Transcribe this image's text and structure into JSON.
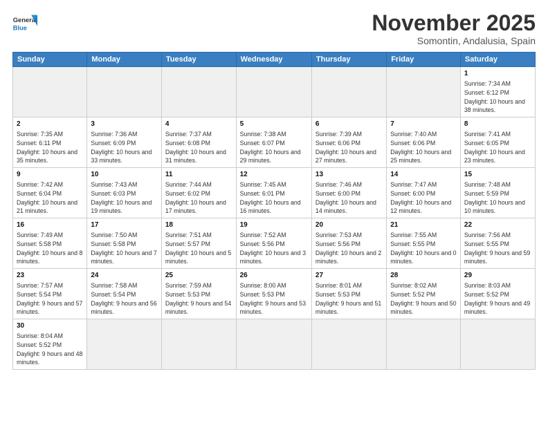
{
  "logo": {
    "line1": "General",
    "line2": "Blue"
  },
  "title": "November 2025",
  "subtitle": "Somontin, Andalusia, Spain",
  "weekdays": [
    "Sunday",
    "Monday",
    "Tuesday",
    "Wednesday",
    "Thursday",
    "Friday",
    "Saturday"
  ],
  "weeks": [
    [
      {
        "day": "",
        "info": ""
      },
      {
        "day": "",
        "info": ""
      },
      {
        "day": "",
        "info": ""
      },
      {
        "day": "",
        "info": ""
      },
      {
        "day": "",
        "info": ""
      },
      {
        "day": "",
        "info": ""
      },
      {
        "day": "1",
        "info": "Sunrise: 7:34 AM\nSunset: 6:12 PM\nDaylight: 10 hours and 38 minutes."
      }
    ],
    [
      {
        "day": "2",
        "info": "Sunrise: 7:35 AM\nSunset: 6:11 PM\nDaylight: 10 hours and 35 minutes."
      },
      {
        "day": "3",
        "info": "Sunrise: 7:36 AM\nSunset: 6:09 PM\nDaylight: 10 hours and 33 minutes."
      },
      {
        "day": "4",
        "info": "Sunrise: 7:37 AM\nSunset: 6:08 PM\nDaylight: 10 hours and 31 minutes."
      },
      {
        "day": "5",
        "info": "Sunrise: 7:38 AM\nSunset: 6:07 PM\nDaylight: 10 hours and 29 minutes."
      },
      {
        "day": "6",
        "info": "Sunrise: 7:39 AM\nSunset: 6:06 PM\nDaylight: 10 hours and 27 minutes."
      },
      {
        "day": "7",
        "info": "Sunrise: 7:40 AM\nSunset: 6:06 PM\nDaylight: 10 hours and 25 minutes."
      },
      {
        "day": "8",
        "info": "Sunrise: 7:41 AM\nSunset: 6:05 PM\nDaylight: 10 hours and 23 minutes."
      }
    ],
    [
      {
        "day": "9",
        "info": "Sunrise: 7:42 AM\nSunset: 6:04 PM\nDaylight: 10 hours and 21 minutes."
      },
      {
        "day": "10",
        "info": "Sunrise: 7:43 AM\nSunset: 6:03 PM\nDaylight: 10 hours and 19 minutes."
      },
      {
        "day": "11",
        "info": "Sunrise: 7:44 AM\nSunset: 6:02 PM\nDaylight: 10 hours and 17 minutes."
      },
      {
        "day": "12",
        "info": "Sunrise: 7:45 AM\nSunset: 6:01 PM\nDaylight: 10 hours and 16 minutes."
      },
      {
        "day": "13",
        "info": "Sunrise: 7:46 AM\nSunset: 6:00 PM\nDaylight: 10 hours and 14 minutes."
      },
      {
        "day": "14",
        "info": "Sunrise: 7:47 AM\nSunset: 6:00 PM\nDaylight: 10 hours and 12 minutes."
      },
      {
        "day": "15",
        "info": "Sunrise: 7:48 AM\nSunset: 5:59 PM\nDaylight: 10 hours and 10 minutes."
      }
    ],
    [
      {
        "day": "16",
        "info": "Sunrise: 7:49 AM\nSunset: 5:58 PM\nDaylight: 10 hours and 8 minutes."
      },
      {
        "day": "17",
        "info": "Sunrise: 7:50 AM\nSunset: 5:58 PM\nDaylight: 10 hours and 7 minutes."
      },
      {
        "day": "18",
        "info": "Sunrise: 7:51 AM\nSunset: 5:57 PM\nDaylight: 10 hours and 5 minutes."
      },
      {
        "day": "19",
        "info": "Sunrise: 7:52 AM\nSunset: 5:56 PM\nDaylight: 10 hours and 3 minutes."
      },
      {
        "day": "20",
        "info": "Sunrise: 7:53 AM\nSunset: 5:56 PM\nDaylight: 10 hours and 2 minutes."
      },
      {
        "day": "21",
        "info": "Sunrise: 7:55 AM\nSunset: 5:55 PM\nDaylight: 10 hours and 0 minutes."
      },
      {
        "day": "22",
        "info": "Sunrise: 7:56 AM\nSunset: 5:55 PM\nDaylight: 9 hours and 59 minutes."
      }
    ],
    [
      {
        "day": "23",
        "info": "Sunrise: 7:57 AM\nSunset: 5:54 PM\nDaylight: 9 hours and 57 minutes."
      },
      {
        "day": "24",
        "info": "Sunrise: 7:58 AM\nSunset: 5:54 PM\nDaylight: 9 hours and 56 minutes."
      },
      {
        "day": "25",
        "info": "Sunrise: 7:59 AM\nSunset: 5:53 PM\nDaylight: 9 hours and 54 minutes."
      },
      {
        "day": "26",
        "info": "Sunrise: 8:00 AM\nSunset: 5:53 PM\nDaylight: 9 hours and 53 minutes."
      },
      {
        "day": "27",
        "info": "Sunrise: 8:01 AM\nSunset: 5:53 PM\nDaylight: 9 hours and 51 minutes."
      },
      {
        "day": "28",
        "info": "Sunrise: 8:02 AM\nSunset: 5:52 PM\nDaylight: 9 hours and 50 minutes."
      },
      {
        "day": "29",
        "info": "Sunrise: 8:03 AM\nSunset: 5:52 PM\nDaylight: 9 hours and 49 minutes."
      }
    ],
    [
      {
        "day": "30",
        "info": "Sunrise: 8:04 AM\nSunset: 5:52 PM\nDaylight: 9 hours and 48 minutes."
      },
      {
        "day": "",
        "info": ""
      },
      {
        "day": "",
        "info": ""
      },
      {
        "day": "",
        "info": ""
      },
      {
        "day": "",
        "info": ""
      },
      {
        "day": "",
        "info": ""
      },
      {
        "day": "",
        "info": ""
      }
    ]
  ]
}
